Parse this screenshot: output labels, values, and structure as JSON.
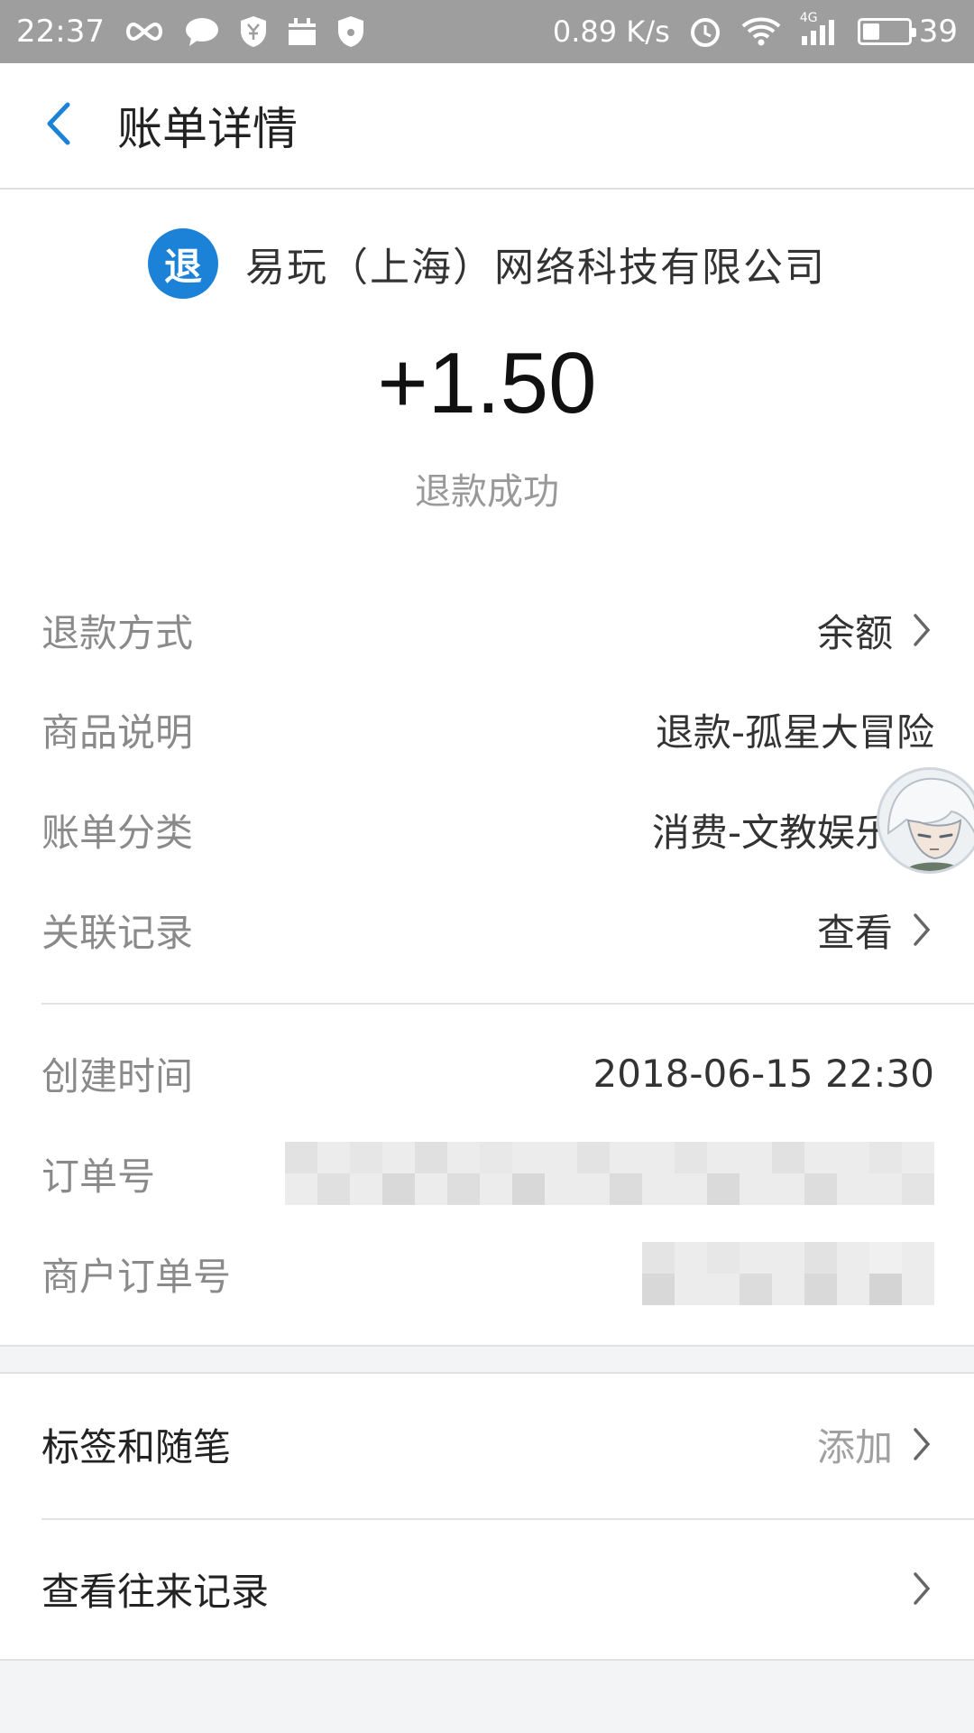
{
  "status_bar": {
    "time": "22:37",
    "net_speed": "0.89 K/s",
    "network": "4G",
    "battery": "39",
    "battery_level": 0.39,
    "icons": [
      "infinity-icon",
      "chat-icon",
      "shield-yen-icon",
      "calendar-icon",
      "shield-icon",
      "alarm-icon",
      "wifi-icon",
      "signal-icon",
      "battery-icon"
    ]
  },
  "header": {
    "title": "账单详情",
    "back_icon": "chevron-left-icon"
  },
  "merchant": {
    "badge": "退",
    "name": "易玩（上海）网络科技有限公司"
  },
  "amount": "+1.50",
  "status": "退款成功",
  "details": [
    {
      "label": "退款方式",
      "value": "余额",
      "chevron": true
    },
    {
      "label": "商品说明",
      "value": "退款-孤星大冒险",
      "chevron": false
    },
    {
      "label": "账单分类",
      "value": "消费-文教娱乐",
      "chevron": true
    },
    {
      "label": "关联记录",
      "value": "查看",
      "chevron": true
    }
  ],
  "info": {
    "created_label": "创建时间",
    "created_value": "2018-06-15 22:30",
    "order_label": "订单号",
    "merchant_order_label": "商户订单号"
  },
  "sections": {
    "tags_label": "标签和随笔",
    "tags_action": "添加",
    "history_label": "查看往来记录"
  },
  "colors": {
    "accent": "#1b82d8",
    "status_bar": "#9e9e9e",
    "band": "#f3f4f6"
  }
}
